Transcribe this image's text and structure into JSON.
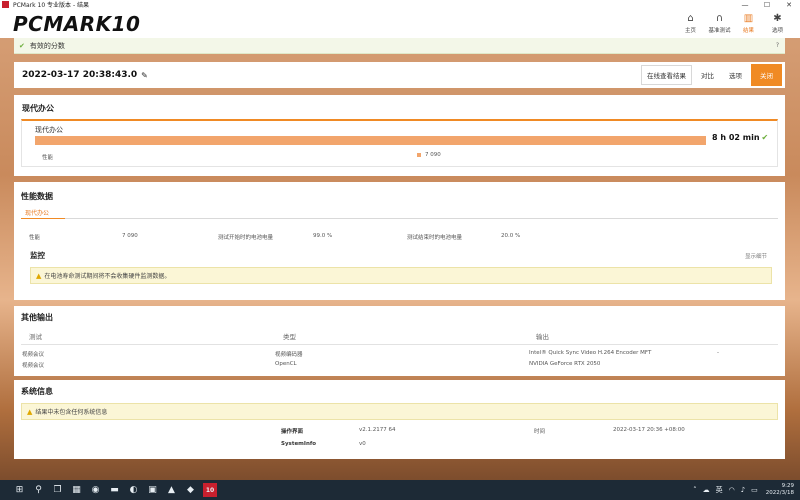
{
  "window": {
    "title": "PCMark 10 专业版本 - 结果"
  },
  "brand": {
    "logo_text": "PCMARK",
    "logo_num": "10"
  },
  "nav": [
    {
      "label": "主页",
      "icon": "home-icon"
    },
    {
      "label": "基准测试",
      "icon": "headset-icon"
    },
    {
      "label": "结果",
      "icon": "bar-chart-icon",
      "active": true
    },
    {
      "label": "选项",
      "icon": "gear-icon"
    }
  ],
  "notification": {
    "text": "有效的分数",
    "help": "?"
  },
  "result": {
    "datetime": "2022-03-17 20:38:43.0",
    "buttons": {
      "view_online": "在线查看结果",
      "compare": "对比",
      "options": "选项",
      "close": "关闭"
    }
  },
  "modern_office": {
    "section_title": "现代办公",
    "box_label": "现代办公",
    "duration": "8 h 02 min",
    "metric_label": "性能",
    "score": "7 090",
    "bar_fraction": 1.0
  },
  "performance": {
    "section_title": "性能数据",
    "tab": "现代办公",
    "row": {
      "perf_label": "性能",
      "perf_value": "7 090",
      "start_battery_label": "测试开始时的电池电量",
      "start_battery_value": "99.0 %",
      "end_battery_label": "测试结束时的电池电量",
      "end_battery_value": "20.0 %"
    },
    "monitor_title": "监控",
    "monitor_link": "显示细节",
    "warning": "在电池寿命测试期间将不会收集硬件监测数据。"
  },
  "other_output": {
    "section_title": "其他输出",
    "headers": [
      "测试",
      "类型",
      "输出"
    ],
    "rows": [
      {
        "test": "视频会议",
        "type": "视频编码器",
        "output": "Intel® Quick Sync Video H.264 Encoder MFT",
        "extra": "-"
      },
      {
        "test": "视频会议",
        "type": "OpenCL",
        "output": "NVIDIA GeForce RTX 2050",
        "extra": ""
      }
    ]
  },
  "system_info": {
    "section_title": "系统信息",
    "warning": "结果中未包含任何系统信息",
    "rows": [
      {
        "label": "操作界面",
        "value": "v2.1.2177 64",
        "label2": "时间",
        "value2": "2022-03-17 20:36 +08:00"
      },
      {
        "label": "SystemInfo",
        "value": "v0",
        "label2": "",
        "value2": ""
      }
    ]
  },
  "taskbar": {
    "time": "9:29",
    "date": "2022/3/18",
    "lang": "英"
  }
}
